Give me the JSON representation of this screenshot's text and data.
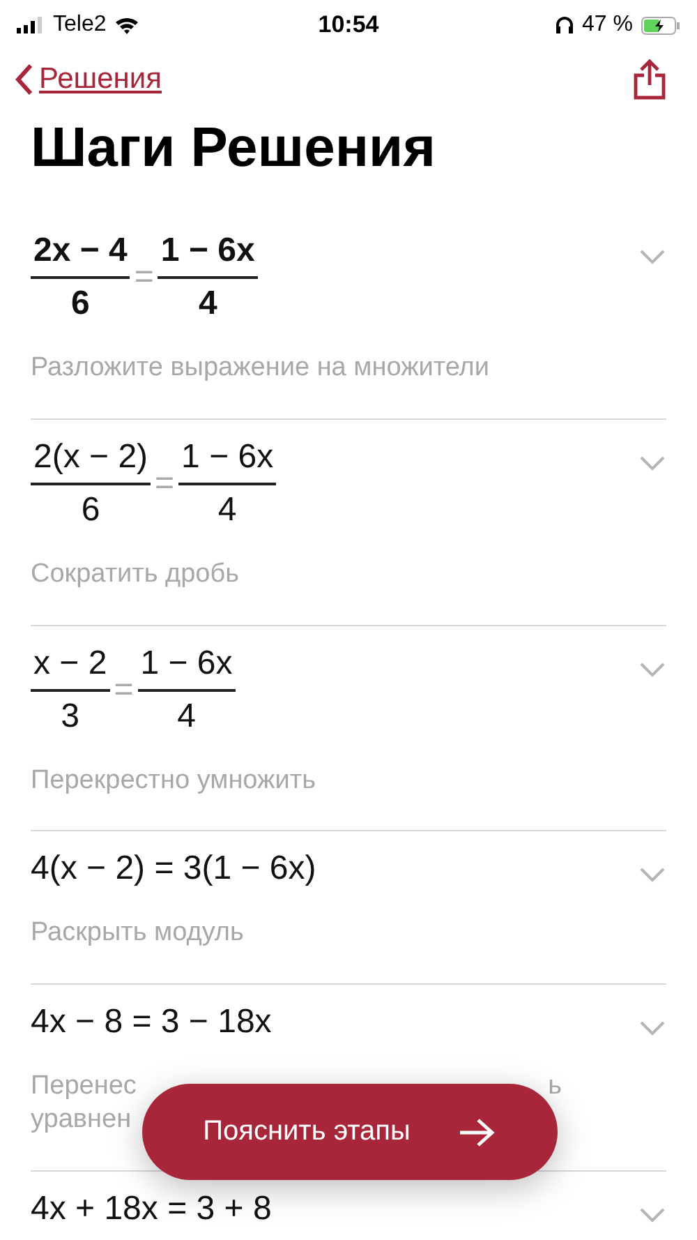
{
  "status_bar": {
    "carrier": "Tele2",
    "time": "10:54",
    "battery": "47 %"
  },
  "nav": {
    "back": "Решения"
  },
  "title": "Шаги Решения",
  "steps": [
    {
      "expanded": false,
      "expression": {
        "kind": "fraction_equation",
        "bold": true,
        "relation": "=",
        "left": {
          "num": "2x − 4",
          "den": "6"
        },
        "right": {
          "num": "1 − 6x",
          "den": "4"
        }
      },
      "description": [
        {
          "left": "Разложите выражение на множители"
        }
      ]
    },
    {
      "expanded": false,
      "expression": {
        "kind": "fraction_equation",
        "bold": false,
        "relation": "=",
        "left": {
          "num": "2(x − 2)",
          "den": "6"
        },
        "right": {
          "num": "1 − 6x",
          "den": "4"
        }
      },
      "description": [
        {
          "left": "Сократить дробь"
        }
      ]
    },
    {
      "expanded": false,
      "expression": {
        "kind": "fraction_equation",
        "bold": false,
        "relation": "=",
        "left": {
          "num": "x − 2",
          "den": "3"
        },
        "right": {
          "num": "1 − 6x",
          "den": "4"
        }
      },
      "description": [
        {
          "left": "Перекрестно умножить"
        }
      ]
    },
    {
      "expanded": false,
      "expression": {
        "kind": "linear",
        "text": "4(x − 2) = 3(1 − 6x)"
      },
      "description": [
        {
          "left": "Раскрыть модуль"
        }
      ]
    },
    {
      "expanded": false,
      "expression": {
        "kind": "linear",
        "text": "4x − 8 = 3 − 18x"
      },
      "description": [
        {
          "left": "Перенес",
          "right": "ь"
        },
        {
          "left": "уравнен"
        }
      ]
    },
    {
      "expanded": false,
      "expression": {
        "kind": "linear",
        "text": "4x + 18x = 3 + 8"
      }
    }
  ],
  "explain_button": {
    "label": "Пояснить этапы"
  }
}
